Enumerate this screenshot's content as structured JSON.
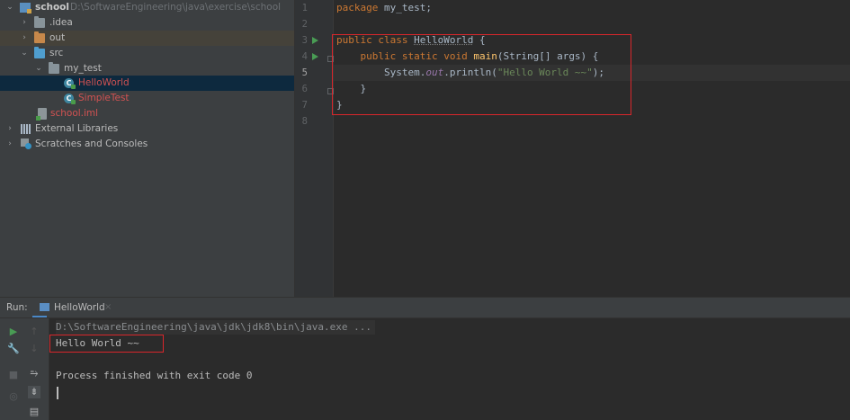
{
  "project_tree": {
    "root": {
      "name": "school",
      "path": "D:\\SoftwareEngineering\\java\\exercise\\school"
    },
    "idea": "idea",
    "out": "out",
    "src": "src",
    "package": "my_test",
    "class_selected": "HelloWorld",
    "class_other": "SimpleTest",
    "iml": "school.iml",
    "external_libraries": "External Libraries",
    "scratches": "Scratches and Consoles"
  },
  "editor": {
    "line_numbers": [
      "1",
      "2",
      "3",
      "4",
      "5",
      "6",
      "7",
      "8"
    ],
    "line1": {
      "kw": "package",
      "rest": " my_test;"
    },
    "line3": {
      "kw": "public class",
      "sp": " ",
      "cls": "HelloWorld",
      "rest": " {"
    },
    "line4": {
      "indent": "    ",
      "kw": "public static void",
      "sp": " ",
      "fn": "main",
      "rest": "(String[] args) {"
    },
    "line5": {
      "indent": "        ",
      "a": "System.",
      "it": "out",
      "b": ".println(",
      "str": "\"Hello World ~~\"",
      "c": ");"
    },
    "line6": "    }",
    "line7": "}"
  },
  "run": {
    "label": "Run:",
    "tab": "HelloWorld",
    "tab_close": "×",
    "command": "D:\\SoftwareEngineering\\java\\jdk\\jdk8\\bin\\java.exe ...",
    "output": "Hello World ~~",
    "finished": "Process finished with exit code 0"
  },
  "colors": {
    "highlight_box": "#d8262b",
    "run_arrow": "#499c54",
    "keyword": "#cc7832",
    "string": "#6a8759"
  }
}
